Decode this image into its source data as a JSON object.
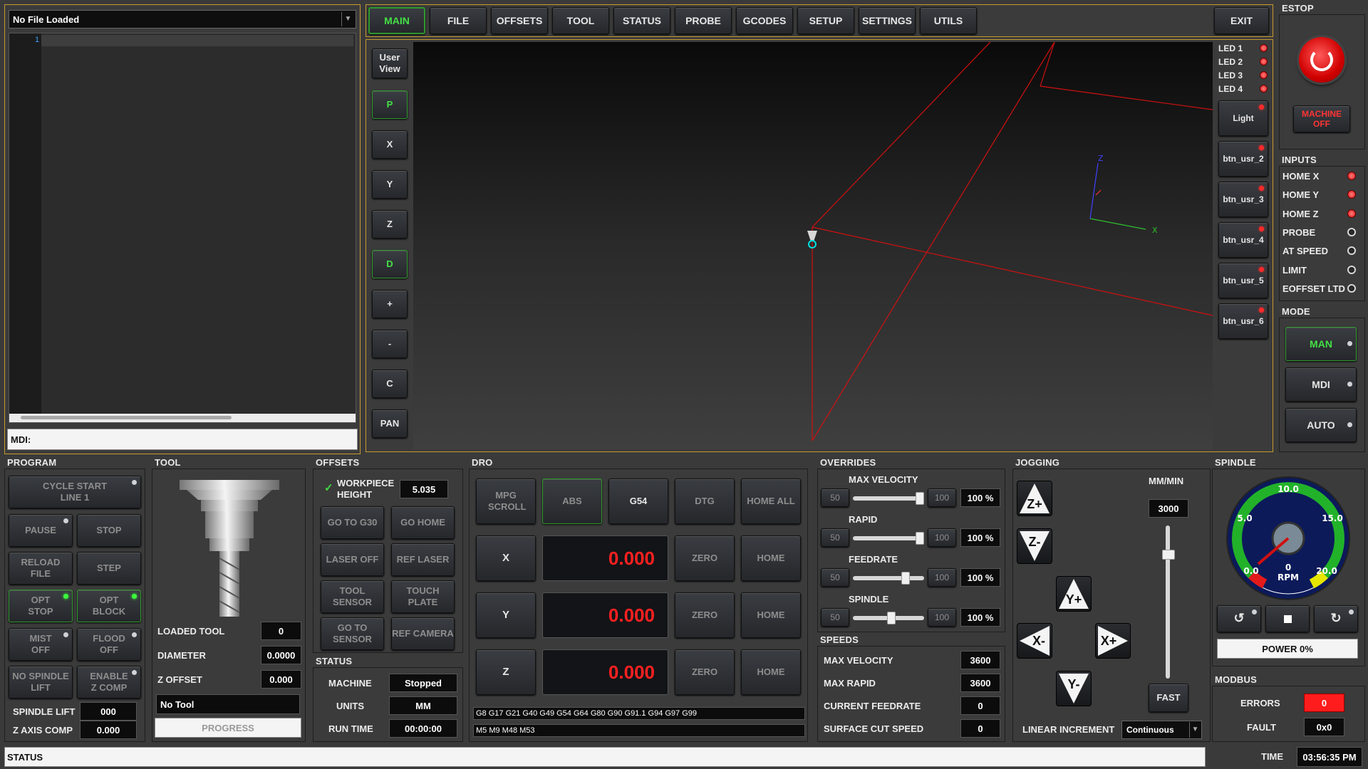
{
  "file": {
    "name": "No File Loaded",
    "line_number": "1",
    "mdi_label": "MDI:"
  },
  "tabs": [
    {
      "label": "MAIN"
    },
    {
      "label": "FILE"
    },
    {
      "label": "OFFSETS"
    },
    {
      "label": "TOOL"
    },
    {
      "label": "STATUS"
    },
    {
      "label": "PROBE"
    },
    {
      "label": "GCODES"
    },
    {
      "label": "SETUP"
    },
    {
      "label": "SETTINGS"
    },
    {
      "label": "UTILS"
    }
  ],
  "exit_label": "EXIT",
  "view_buttons": [
    "User View",
    "P",
    "X",
    "Y",
    "Z",
    "D",
    "+",
    "-",
    "C",
    "PAN"
  ],
  "axes3d": {
    "x": "X",
    "y": "Y",
    "z": "Z"
  },
  "leds": [
    "LED 1",
    "LED 2",
    "LED 3",
    "LED 4"
  ],
  "user_buttons": [
    "Light",
    "btn_usr_2",
    "btn_usr_3",
    "btn_usr_4",
    "btn_usr_5",
    "btn_usr_6"
  ],
  "estop": {
    "title": "ESTOP",
    "machine_btn": "MACHINE OFF"
  },
  "inputs": {
    "title": "INPUTS",
    "items": [
      {
        "label": "HOME X",
        "state": "on"
      },
      {
        "label": "HOME Y",
        "state": "on"
      },
      {
        "label": "HOME Z",
        "state": "on"
      },
      {
        "label": "PROBE",
        "state": "off"
      },
      {
        "label": "AT SPEED",
        "state": "off"
      },
      {
        "label": "LIMIT",
        "state": "off"
      },
      {
        "label": "EOFFSET LTD",
        "state": "off"
      }
    ]
  },
  "mode": {
    "title": "MODE",
    "items": [
      "MAN",
      "MDI",
      "AUTO"
    ]
  },
  "program": {
    "title": "PROGRAM",
    "cycle_start": "CYCLE START LINE 1",
    "pause": "PAUSE",
    "stop": "STOP",
    "reload": "RELOAD FILE",
    "step": "STEP",
    "opt_stop": "OPT STOP",
    "opt_block": "OPT BLOCK",
    "mist": "MIST OFF",
    "flood": "FLOOD OFF",
    "no_spindle_lift": "NO SPINDLE LIFT",
    "enable_z_comp": "ENABLE Z COMP",
    "spindle_lift_label": "SPINDLE LIFT",
    "spindle_lift_value": "000",
    "z_axis_comp_label": "Z AXIS COMP",
    "z_axis_comp_value": "0.000"
  },
  "tool": {
    "title": "TOOL",
    "loaded_label": "LOADED TOOL",
    "loaded_value": "0",
    "diameter_label": "DIAMETER",
    "diameter_value": "0.0000",
    "z_offset_label": "Z OFFSET",
    "z_offset_value": "0.000",
    "tool_name": "No Tool",
    "progress": "PROGRESS"
  },
  "offsets": {
    "title": "OFFSETS",
    "workpiece_label": "WORKPIECE HEIGHT",
    "workpiece_value": "5.035",
    "buttons": [
      "GO TO G30",
      "GO HOME",
      "LASER OFF",
      "REF LASER",
      "TOOL SENSOR",
      "TOUCH PLATE",
      "GO TO SENSOR",
      "REF CAMERA"
    ]
  },
  "status_box": {
    "title": "STATUS",
    "machine_label": "MACHINE",
    "machine_value": "Stopped",
    "units_label": "UNITS",
    "units_value": "MM",
    "runtime_label": "RUN TIME",
    "runtime_value": "00:00:00"
  },
  "dro": {
    "title": "DRO",
    "mpg": "MPG SCROLL",
    "abs": "ABS",
    "g54": "G54",
    "dtg": "DTG",
    "home_all": "HOME ALL",
    "zero": "ZERO",
    "home": "HOME",
    "axes": [
      {
        "name": "X",
        "value": "0.000"
      },
      {
        "name": "Y",
        "value": "0.000"
      },
      {
        "name": "Z",
        "value": "0.000"
      }
    ],
    "gcodes": "G8 G17 G21 G40 G49 G54 G64 G80 G90 G91.1 G94 G97 G99",
    "mcodes": "M5 M9 M48 M53"
  },
  "overrides": {
    "title": "OVERRIDES",
    "items": [
      {
        "label": "MAX VELOCITY",
        "min": "50",
        "max": "100",
        "value": "100 %",
        "level": 1.0
      },
      {
        "label": "RAPID",
        "min": "50",
        "max": "100",
        "value": "100 %",
        "level": 1.0
      },
      {
        "label": "FEEDRATE",
        "min": "50",
        "max": "100",
        "value": "100 %",
        "level": 0.8
      },
      {
        "label": "SPINDLE",
        "min": "50",
        "max": "100",
        "value": "100 %",
        "level": 0.6
      }
    ]
  },
  "speeds": {
    "title": "SPEEDS",
    "items": [
      {
        "label": "MAX VELOCITY",
        "value": "3600"
      },
      {
        "label": "MAX RAPID",
        "value": "3600"
      },
      {
        "label": "CURRENT FEEDRATE",
        "value": "0"
      },
      {
        "label": "SURFACE CUT SPEED",
        "value": "0"
      }
    ]
  },
  "jogging": {
    "title": "JOGGING",
    "units": "MM/MIN",
    "rate": "3000",
    "fast": "FAST",
    "linear_label": "LINEAR INCREMENT",
    "linear_value": "Continuous",
    "buttons": [
      "Z+",
      "Z-",
      "Y+",
      "X-",
      "X+",
      "Y-"
    ]
  },
  "spindle": {
    "title": "SPINDLE",
    "gauge_labels": [
      "10.0",
      "5.0",
      "15.0",
      "0.0",
      "20.0"
    ],
    "rpm_value": "0",
    "rpm_label": "RPM",
    "power": "POWER 0%"
  },
  "modbus": {
    "title": "MODBUS",
    "errors_label": "ERRORS",
    "errors_value": "0",
    "fault_label": "FAULT",
    "fault_value": "0x0"
  },
  "status_bar": {
    "text": "STATUS",
    "time_label": "TIME",
    "time_value": "03:56:35 PM"
  }
}
